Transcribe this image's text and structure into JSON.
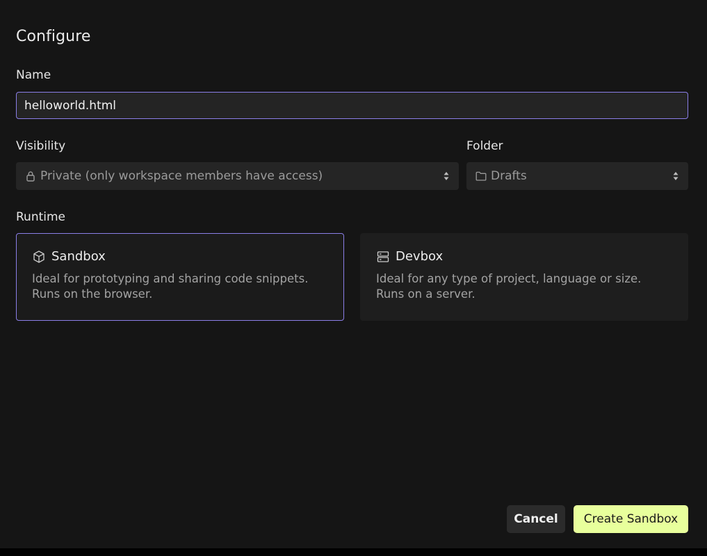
{
  "dialog": {
    "title": "Configure"
  },
  "name": {
    "label": "Name",
    "value": "helloworld.html"
  },
  "visibility": {
    "label": "Visibility",
    "icon": "lock-icon",
    "selected": "Private (only workspace members have access)"
  },
  "folder": {
    "label": "Folder",
    "icon": "folder-icon",
    "selected": "Drafts"
  },
  "runtime": {
    "label": "Runtime",
    "options": [
      {
        "title": "Sandbox",
        "icon": "cube-icon",
        "line1": "Ideal for prototyping and sharing code snippets.",
        "line2": "Runs on the browser.",
        "selected": true
      },
      {
        "title": "Devbox",
        "icon": "server-icon",
        "line1": "Ideal for any type of project, language or size.",
        "line2": "Runs on a server.",
        "selected": false
      }
    ]
  },
  "actions": {
    "cancel_label": "Cancel",
    "create_label": "Create Sandbox"
  },
  "colors": {
    "accent_border": "#8b7fe8",
    "primary_button": "#e8ff9c",
    "background": "#151515"
  }
}
